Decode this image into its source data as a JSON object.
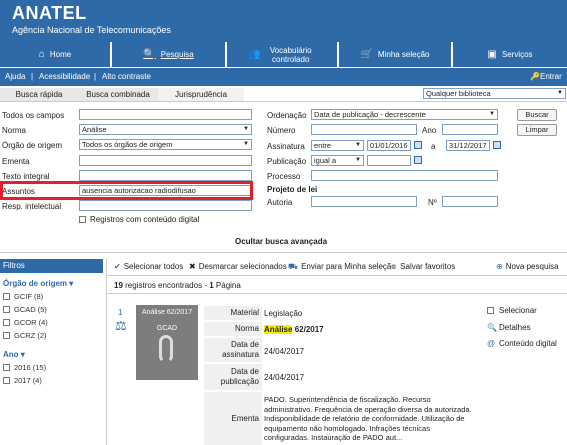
{
  "brand": {
    "name": "ANATEL",
    "subtitle": "Agência Nacional de Telecomunicações"
  },
  "nav": [
    {
      "label": "Home",
      "icon": "home-icon",
      "glyph": "⌂"
    },
    {
      "label": "Pesquisa",
      "icon": "search-icon",
      "glyph": "🔍"
    },
    {
      "label": "Vocabulário controlado",
      "icon": "vocabulary-icon",
      "glyph": "👥"
    },
    {
      "label": "Minha seleção",
      "icon": "basket-icon",
      "glyph": "🛒"
    },
    {
      "label": "Serviços",
      "icon": "services-icon",
      "glyph": "▣"
    }
  ],
  "util": {
    "ajuda": "Ajuda",
    "sep": "|",
    "acessibilidade": "Acessibilidade",
    "contraste": "Alto contraste",
    "entrar": "Entrar",
    "entrar_glyph": "🔑"
  },
  "tabs": {
    "rapida": "Busca rápida",
    "combinada": "Busca combinada",
    "juris": "Jurisprudência"
  },
  "library": "Qualquer biblioteca",
  "left_form": {
    "todos": "Todos os campos",
    "todos_val": "",
    "norma": "Norma",
    "norma_val": "Análise",
    "orgao": "Órgão de origem",
    "orgao_val": "Todos os órgãos de origem",
    "ementa": "Ementa",
    "ementa_val": "",
    "texto": "Texto integral",
    "texto_val": "",
    "assuntos": "Assuntos",
    "assuntos_val": "ausencia autorizacao radiodifusao",
    "resp": "Resp. intelectual",
    "resp_val": "",
    "registros_dig": "Registros com conteúdo digital"
  },
  "right_form": {
    "ordenacao": "Ordenação",
    "ordenacao_val": "Data de publicação - decrescente",
    "numero": "Número",
    "numero_val": "",
    "ano": "Ano",
    "ano_val": "",
    "assinatura": "Assinatura",
    "assinatura_op": "entre",
    "assinatura_de": "01/01/2016",
    "a": "a",
    "assinatura_ate": "31/12/2017",
    "publicacao": "Publicação",
    "publicacao_op": "igual a",
    "processo": "Processo",
    "processo_val": "",
    "projeto": "Projeto de lei",
    "autoria": "Autoria",
    "autoria_val": "",
    "no": "Nº",
    "no_val": ""
  },
  "buttons": {
    "buscar": "Buscar",
    "limpar": "Limpar"
  },
  "ocultar": "Ocultar busca avançada",
  "filters": {
    "title": "Filtros",
    "orgao_title": "Órgão de origem",
    "orgao_items": [
      "GCIF (8)",
      "GCAD (5)",
      "GCOR (4)",
      "GCRZ (2)"
    ],
    "ano_title": "Ano",
    "ano_items": [
      "2016 (15)",
      "2017 (4)"
    ]
  },
  "toolbar": {
    "selecionar": "Selecionar todos",
    "desmarcar": "Desmarcar selecionados",
    "enviar": "Enviar para Minha seleção",
    "salvar": "Salvar favoritos",
    "nova": "Nova pesquisa"
  },
  "results": {
    "count": "19",
    "count_text": "registros encontrados",
    "dash": "-",
    "pages": "1",
    "pages_text": "Página"
  },
  "record": {
    "index": "1",
    "thumb_title": "Análise 62/2017",
    "thumb_org": "GCAD",
    "material_l": "Material",
    "material_v": "Legislação",
    "norma_l": "Norma",
    "norma_hl": "Análise",
    "norma_rest": "62/2017",
    "assin_l": "Data de assinatura",
    "assin_v": "24/04/2017",
    "pub_l": "Data de publicação",
    "pub_v": "24/04/2017",
    "ementa_l": "Ementa",
    "ementa_v": "PADO. Superintendência de fiscalização. Recurso administrativo. Frequência de operação diversa da autorizada. Indisponibilidade de relatório de conformidade. Utilização de equipamento não homologado. Infrações técnicas configuradas. Instauração de PADO aut..."
  },
  "side": {
    "selecionar": "Selecionar",
    "detalhes": "Detalhes",
    "digital": "Conteúdo digital"
  },
  "colors": {
    "brand": "#2f6aa8",
    "highlight": "#f7f000",
    "red": "#e0202a"
  }
}
